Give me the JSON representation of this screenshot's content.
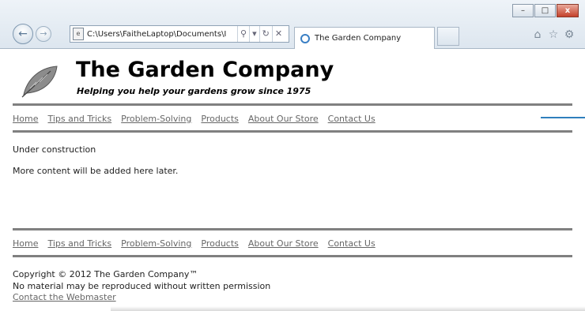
{
  "browser": {
    "address_url": "C:\\Users\\FaitheLaptop\\Documents\\I",
    "tab_title": "The Garden Company",
    "window_buttons": {
      "minimize": "–",
      "maximize": "□",
      "close": "x"
    },
    "icons": [
      "back-arrow-icon",
      "forward-arrow-icon",
      "page-icon",
      "search-icon",
      "dropdown-icon",
      "refresh-icon",
      "stop-icon",
      "ie-icon",
      "home-icon",
      "favorites-star-icon",
      "settings-gear-icon"
    ],
    "accent_color": "#2f7fbd"
  },
  "site": {
    "title": "The Garden Company",
    "tagline": "Helping you help your gardens grow since 1975"
  },
  "nav": {
    "items": [
      "Home",
      "Tips and Tricks",
      "Problem-Solving",
      "Products",
      "About Our Store",
      "Contact Us"
    ]
  },
  "content": {
    "line1": "Under construction",
    "line2": "More content will be added here later."
  },
  "footer": {
    "copyright": "Copyright © 2012 The Garden Company™",
    "notice": "No material may be reproduced without written permission",
    "webmaster_link": "Contact the Webmaster"
  }
}
